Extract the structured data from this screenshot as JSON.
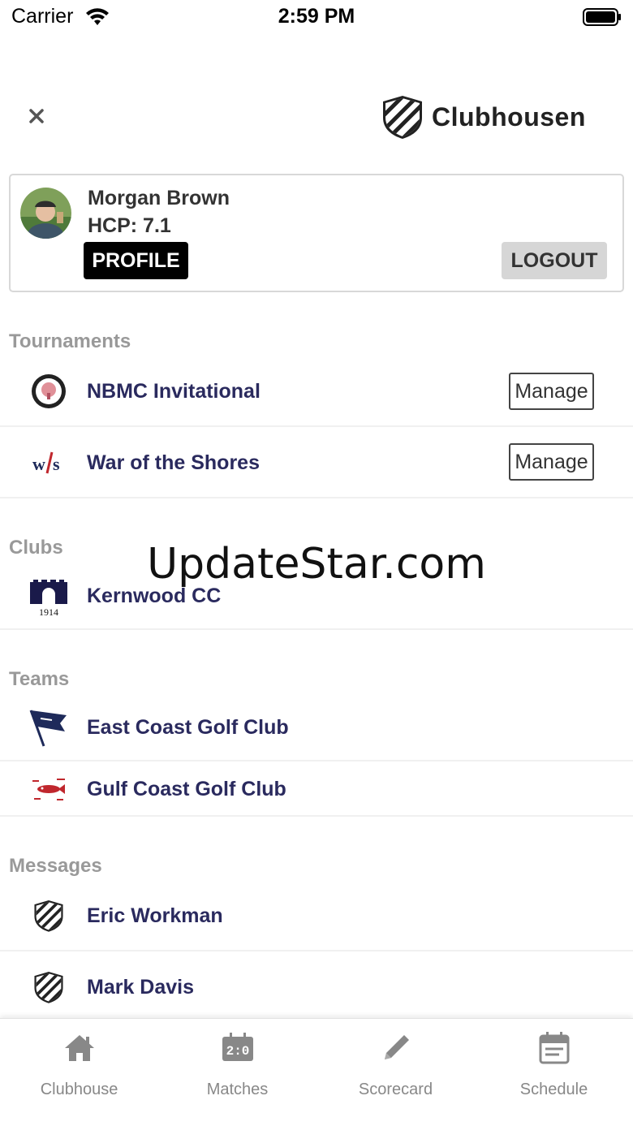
{
  "status_bar": {
    "carrier": "Carrier",
    "time": "2:59 PM"
  },
  "header": {
    "logo_text": "Clubhousen"
  },
  "user": {
    "name": "Morgan Brown",
    "hcp": "HCP: 7.1",
    "profile_label": "PROFILE",
    "logout_label": "LOGOUT"
  },
  "tournaments": {
    "title": "Tournaments",
    "items": [
      {
        "label": "NBMC Invitational",
        "action": "Manage"
      },
      {
        "label": "War of the Shores",
        "action": "Manage"
      }
    ]
  },
  "clubs": {
    "title": "Clubs",
    "items": [
      {
        "label": "Kernwood CC",
        "logo_text": "1914"
      }
    ]
  },
  "teams": {
    "title": "Teams",
    "items": [
      {
        "label": "East Coast Golf Club"
      },
      {
        "label": "Gulf Coast Golf Club"
      }
    ]
  },
  "messages": {
    "title": "Messages",
    "items": [
      {
        "label": "Eric Workman"
      },
      {
        "label": "Mark Davis"
      }
    ]
  },
  "watermark": "UpdateStar.com",
  "tab_bar": {
    "tabs": [
      {
        "label": "Clubhouse",
        "icon": "home-icon"
      },
      {
        "label": "Matches",
        "icon": "scoreboard-icon"
      },
      {
        "label": "Scorecard",
        "icon": "pencil-icon"
      },
      {
        "label": "Schedule",
        "icon": "calendar-icon"
      }
    ]
  },
  "colors": {
    "link_text": "#2a2a5e",
    "section_title": "#999999",
    "tab_label": "#888888"
  }
}
